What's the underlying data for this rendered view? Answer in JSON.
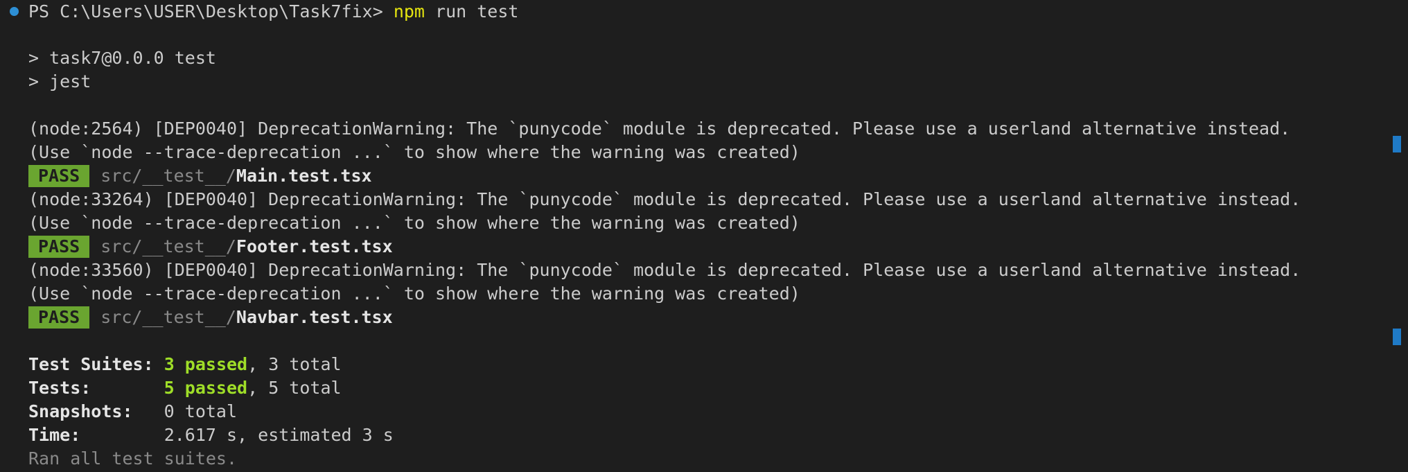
{
  "terminal": {
    "prompt": "PS C:\\Users\\USER\\Desktop\\Task7fix>",
    "command_prefix": "npm",
    "command_rest": "run test",
    "script_line1": "> task7@0.0.0 test",
    "script_line2": "> jest",
    "blocks": [
      {
        "warning": "(node:2564) [DEP0040] DeprecationWarning: The `punycode` module is deprecated. Please use a userland alternative instead.",
        "trace": "(Use `node --trace-deprecation ...` to show where the warning was created)",
        "badge": "PASS",
        "path": "src/__test__/",
        "file": "Main.test.tsx"
      },
      {
        "warning": "(node:33264) [DEP0040] DeprecationWarning: The `punycode` module is deprecated. Please use a userland alternative instead.",
        "trace": "(Use `node --trace-deprecation ...` to show where the warning was created)",
        "badge": "PASS",
        "path": "src/__test__/",
        "file": "Footer.test.tsx"
      },
      {
        "warning": "(node:33560) [DEP0040] DeprecationWarning: The `punycode` module is deprecated. Please use a userland alternative instead.",
        "trace": "(Use `node --trace-deprecation ...` to show where the warning was created)",
        "badge": "PASS",
        "path": "src/__test__/",
        "file": "Navbar.test.tsx"
      }
    ],
    "summary": {
      "suites_label": "Test Suites:",
      "suites_passed": "3 passed",
      "suites_total": ", 3 total",
      "tests_label": "Tests:",
      "tests_passed": "5 passed",
      "tests_total": ", 5 total",
      "snapshots_label": "Snapshots:",
      "snapshots_value": "0 total",
      "time_label": "Time:",
      "time_value": "2.617 s, estimated 3 s",
      "footer": "Ran all test suites."
    },
    "colors": {
      "background": "#1e1e1e",
      "pass_badge": "#6aa530",
      "passed_text": "#9fde28",
      "command": "#e5e510",
      "prompt_dot": "#2d8fd5"
    }
  }
}
